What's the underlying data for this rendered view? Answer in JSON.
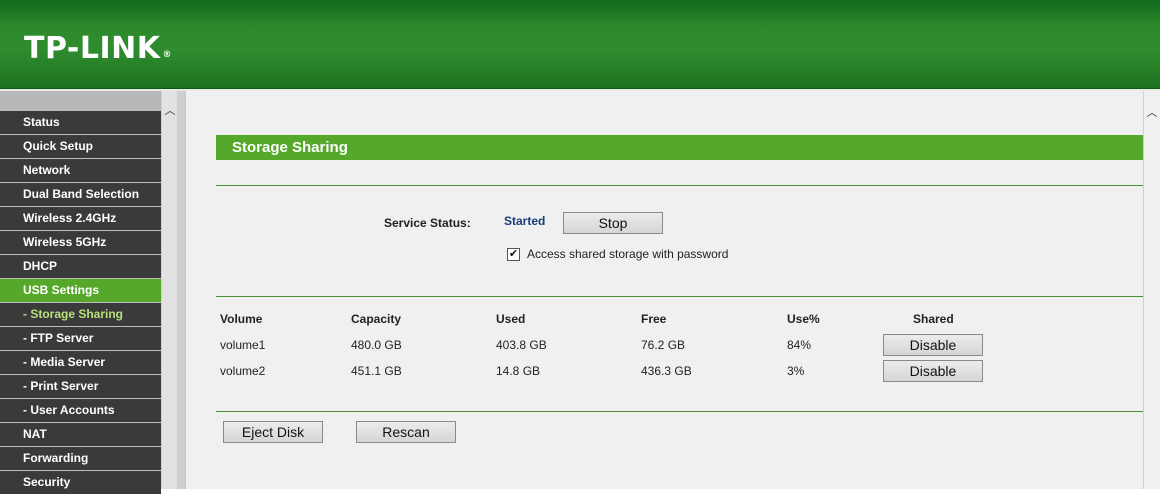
{
  "header": {
    "logo": "TP-LINK",
    "logo_mark": "®"
  },
  "sidebar": {
    "items": [
      {
        "label": "Status",
        "type": "top"
      },
      {
        "label": "Quick Setup",
        "type": "top"
      },
      {
        "label": "Network",
        "type": "top"
      },
      {
        "label": "Dual Band Selection",
        "type": "top"
      },
      {
        "label": "Wireless 2.4GHz",
        "type": "top"
      },
      {
        "label": "Wireless 5GHz",
        "type": "top"
      },
      {
        "label": "DHCP",
        "type": "top"
      },
      {
        "label": "USB Settings",
        "type": "active"
      },
      {
        "label": "- Storage Sharing",
        "type": "current"
      },
      {
        "label": "- FTP Server",
        "type": "sub"
      },
      {
        "label": "- Media Server",
        "type": "sub"
      },
      {
        "label": "- Print Server",
        "type": "sub"
      },
      {
        "label": "- User Accounts",
        "type": "sub"
      },
      {
        "label": "NAT",
        "type": "top"
      },
      {
        "label": "Forwarding",
        "type": "top"
      },
      {
        "label": "Security",
        "type": "top"
      }
    ]
  },
  "main": {
    "title": "Storage Sharing",
    "service_status_label": "Service Status:",
    "service_status_value": "Started",
    "stop_button": "Stop",
    "password_checkbox_label": "Access shared storage with password",
    "password_checkbox_checked": true,
    "table": {
      "headers": [
        "Volume",
        "Capacity",
        "Used",
        "Free",
        "Use%",
        "Shared"
      ],
      "rows": [
        {
          "volume": "volume1",
          "capacity": "480.0 GB",
          "used": "403.8 GB",
          "free": "76.2 GB",
          "use_pct": "84%",
          "shared_button": "Disable"
        },
        {
          "volume": "volume2",
          "capacity": "451.1 GB",
          "used": "14.8 GB",
          "free": "436.3 GB",
          "use_pct": "3%",
          "shared_button": "Disable"
        }
      ]
    },
    "eject_button": "Eject Disk",
    "rescan_button": "Rescan"
  },
  "colors": {
    "brand_green": "#2f8d2e",
    "accent_green": "#56a82a",
    "menu_dark": "#3a3a3a",
    "status_blue": "#1a3c7a"
  }
}
